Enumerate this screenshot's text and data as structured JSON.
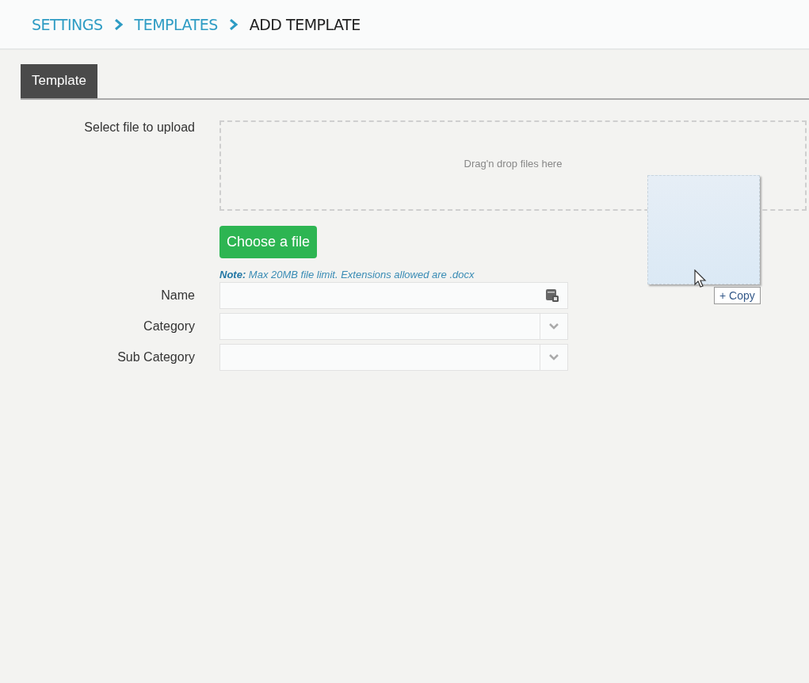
{
  "breadcrumb": [
    {
      "label": "SETTINGS",
      "current": false
    },
    {
      "label": "TEMPLATES",
      "current": false
    },
    {
      "label": "ADD TEMPLATE",
      "current": true
    }
  ],
  "tabs": [
    {
      "label": "Template",
      "selected": true
    }
  ],
  "upload": {
    "label": "Select file to upload",
    "drop_text": "Drag'n drop files here",
    "button": "Choose a file",
    "note": "**Note:** Max 20MB file limit. Extensions allowed are .docx"
  },
  "fields": [
    {
      "label": "Name",
      "kind": "text"
    },
    {
      "label": "Category",
      "kind": "select"
    },
    {
      "label": "Sub Category",
      "kind": "select"
    }
  ],
  "drag": {
    "copy_label": "+ Copy"
  }
}
